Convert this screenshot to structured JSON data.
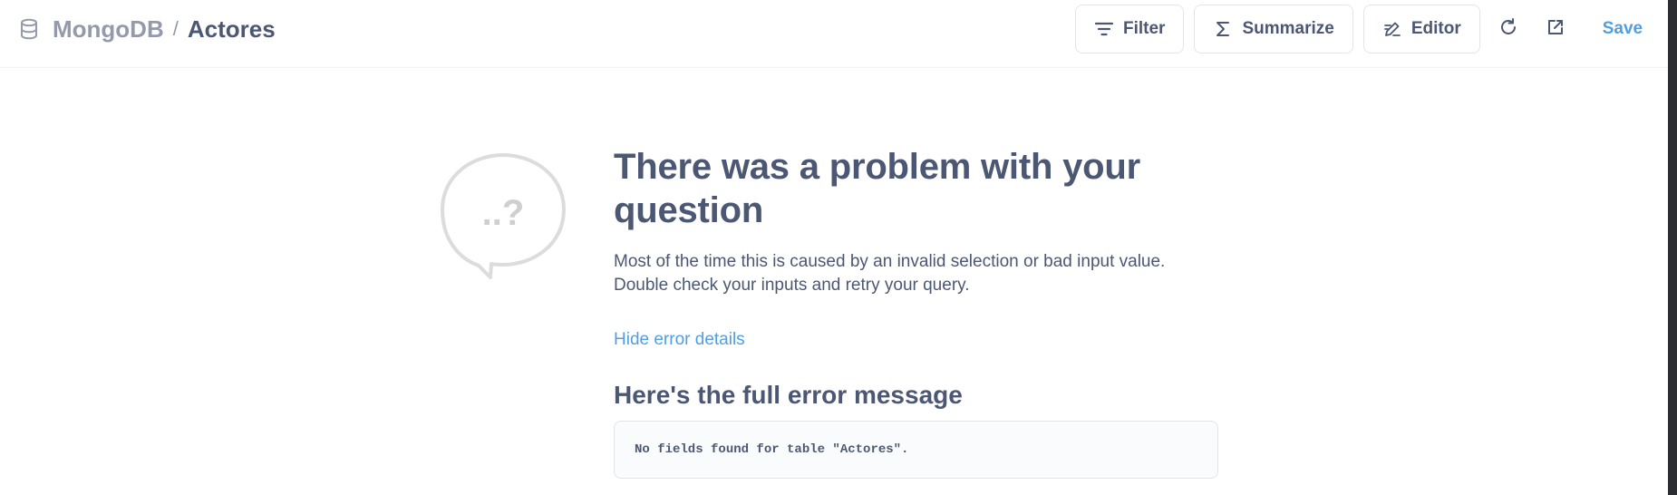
{
  "header": {
    "database": "MongoDB",
    "separator": "/",
    "table": "Actores"
  },
  "toolbar": {
    "filter_label": "Filter",
    "summarize_label": "Summarize",
    "editor_label": "Editor",
    "save_label": "Save"
  },
  "error": {
    "bubble_text": "..?",
    "title": "There was a problem with your question",
    "description": "Most of the time this is caused by an invalid selection or bad input value. Double check your inputs and retry your query.",
    "toggle_label": "Hide error details",
    "details_title": "Here's the full error message",
    "message": "No fields found for table \"Actores\"."
  },
  "colors": {
    "brand": "#509ee3",
    "text": "#4c5773",
    "muted": "#949aab",
    "border": "#e3e5ea"
  },
  "icons": [
    "database-icon",
    "filter-icon",
    "sigma-icon",
    "editor-icon",
    "refresh-icon",
    "open-external-icon",
    "question-bubble-icon"
  ]
}
